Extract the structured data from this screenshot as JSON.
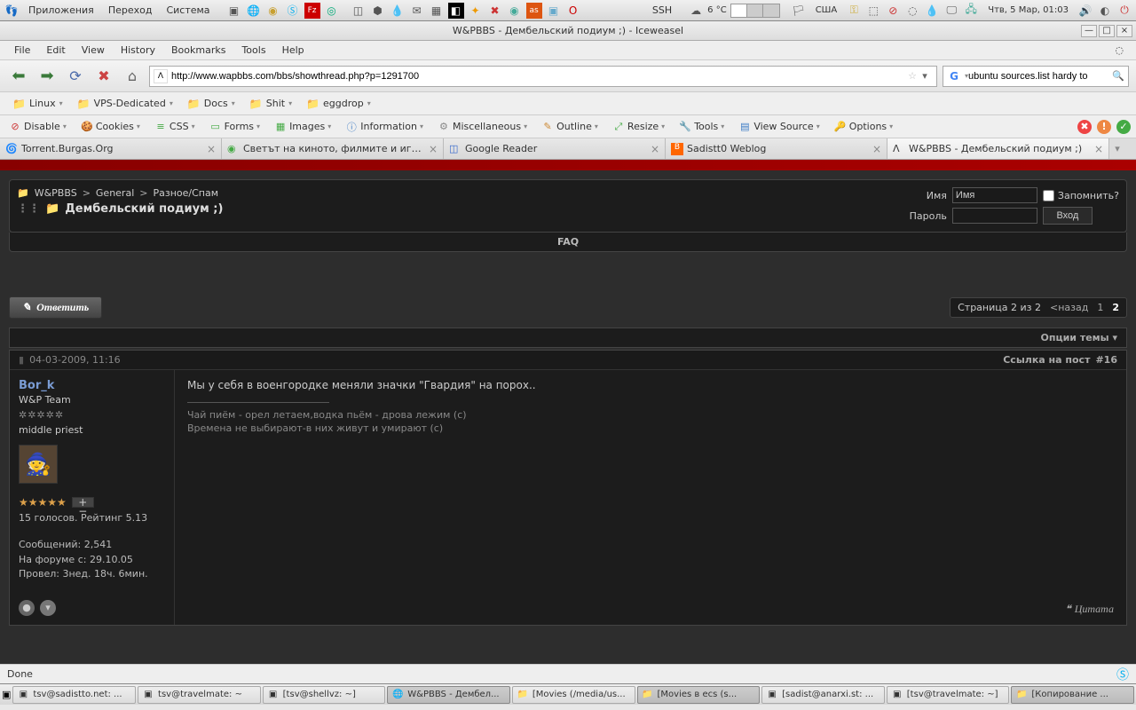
{
  "top_panel": {
    "menus": [
      "Приложения",
      "Переход",
      "Система"
    ],
    "ssh": "SSH",
    "weather": "6 °C",
    "locale": "США",
    "clock": "Чтв,  5 Мар, 01:03"
  },
  "window": {
    "title": "W&PBBS - Дембельский подиум ;) - Iceweasel"
  },
  "browser_menu": [
    "File",
    "Edit",
    "View",
    "History",
    "Bookmarks",
    "Tools",
    "Help"
  ],
  "url": "http://www.wapbbs.com/bbs/showthread.php?p=1291700",
  "search_query": "ubuntu sources.list hardy to",
  "bookmarks": [
    "Linux",
    "VPS-Dedicated",
    "Docs",
    "Shit",
    "eggdrop"
  ],
  "dev_toolbar": [
    "Disable",
    "Cookies",
    "CSS",
    "Forms",
    "Images",
    "Information",
    "Miscellaneous",
    "Outline",
    "Resize",
    "Tools",
    "View Source",
    "Options"
  ],
  "tabs": [
    {
      "title": "Torrent.Burgas.Org"
    },
    {
      "title": "Светът на киното, филмите и игрит..."
    },
    {
      "title": "Google Reader"
    },
    {
      "title": "Sadistt0 Weblog"
    },
    {
      "title": "W&PBBS - Дембельский подиум ;)"
    }
  ],
  "breadcrumb": {
    "root": "W&PBBS",
    "cat": "General",
    "forum": "Разное/Спам",
    "thread": "Дембельский подиум ;)"
  },
  "login": {
    "name_label": "Имя",
    "name_ph": "Имя",
    "pwd_label": "Пароль",
    "remember": "Запомнить?",
    "submit": "Вход"
  },
  "faq": "FAQ",
  "reply_label": "Ответить",
  "pagination": {
    "text": "Страница 2 из 2",
    "back": "<назад",
    "pages": [
      "1",
      "2"
    ],
    "current": "2"
  },
  "thread_opts": "Опции темы",
  "post": {
    "date": "04-03-2009, 11:16",
    "permalink": "Ссылка на пост",
    "num": "#16",
    "user": {
      "name": "Bor_k",
      "title": "W&P Team",
      "title2": "middle priest",
      "rating_text": "15 голосов. Рейтинг 5.13",
      "posts": "Сообщений: 2,541",
      "joined": "На форуме с: 29.10.05",
      "online": "Провел: 3нед. 18ч. 6мин."
    },
    "text": "Мы у себя в военгородке меняли значки \"Гвардия\" на порох..",
    "sig1": "Чай пиём - орел летаем,водка пьём - дрова лежим (с)",
    "sig2": "Времена не выбирают-в них живут и умирают (с)",
    "quote": "Цитата"
  },
  "status_bar": "Done",
  "taskbar": [
    "tsv@sadistto.net: ...",
    "tsv@travelmate: ~",
    "[tsv@shellvz: ~]",
    "W&PBBS - Дембел...",
    "[Movies (/media/us...",
    "[Movies в ecs (s...",
    "[sadist@anarxi.st: ...",
    "[tsv@travelmate: ~]",
    "[Копирование ..."
  ]
}
